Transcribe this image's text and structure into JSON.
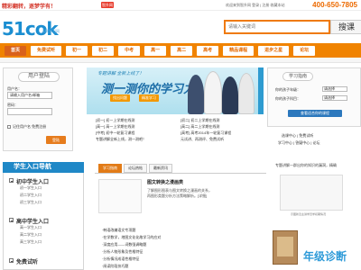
{
  "topbar": {
    "slogan": "精彩翻转，逐梦学有！",
    "badge": "智升网",
    "links": "欢迎来到智升网  登录 | 注册  收藏本站",
    "hotline": "400-650-7805"
  },
  "header": {
    "logo_text": "51cok",
    "logo_sub": "无忧学习网",
    "search_placeholder": "请输入关键词",
    "search_button": "搜课"
  },
  "nav": {
    "items": [
      "首页",
      "免费试听",
      "初一",
      "初二",
      "中考",
      "高一",
      "高二",
      "高考",
      "精品课程",
      "进步之星",
      "论坛"
    ]
  },
  "login": {
    "title": "用户登陆",
    "user_label": "用户名：",
    "user_value": "请输入用户名/邮箱",
    "pass_label": "密码：",
    "remember": "记住用户名",
    "free_register": "免费注册",
    "submit": "登陆"
  },
  "banner": {
    "kicker": "专题讲解  全新上线了！",
    "title": "测一测你的学习力",
    "tag1": "找出问题",
    "tag2": "精准学习",
    "links": [
      "[初一] 初一上学期在线测",
      "[初二] 初二上学期在线测",
      "[高一] 高一上学期在线测",
      "[高二] 高二上学期在线测",
      "[中考] 初中一轮复习课程",
      "[高考] 高考2014年一轮复习课程",
      "专题讲解全新上线，测一测吧！",
      "元试讲、再测评、免费试听"
    ]
  },
  "guide": {
    "title": "学习指南",
    "grade_label": "你的孩子年级：",
    "grade_value": "请选择",
    "subject_label": "你的孩子科目：",
    "subject_value": "请选择",
    "button": "查看适合你的课程",
    "links_row1": "选课中心 | 免费试听",
    "links_row2": "学习中心 | 答疑中心 | 论坛"
  },
  "left_nav": {
    "header": "学生入口导航",
    "sections": [
      {
        "title": "初中学生入口",
        "items": [
          "初一学生入口",
          "初二学生入口",
          "初三学生入口"
        ]
      },
      {
        "title": "高中学生入口",
        "items": [
          "高一学生入口",
          "高二学生入口",
          "高三学生入口"
        ]
      },
      {
        "title": "免费试听",
        "items": []
      }
    ]
  },
  "tabs": [
    "学习指南",
    "论坛热帖",
    "最新资讯"
  ],
  "article": {
    "title": "图文转换之漫画类",
    "lines": [
      "了解图形图表与图文转换之漫画的关系，",
      "再图形类题分析方法策略解析。[详细]"
    ]
  },
  "bullets": [
    "·韩语改编语文专项题",
    "·在学数学，地图文化化故学习的应对",
    "·深度应用——词数强调略题",
    "·分析人物形象及性格特征",
    "·分析情况成语性格特征",
    "·阅读阶段技巧题"
  ],
  "right_bottom": {
    "text": "专题讲解一群出你的知识的漏洞，精确",
    "card_caption": "示图新近主讲学员学初期情况",
    "grade_label": "年级诊断"
  }
}
